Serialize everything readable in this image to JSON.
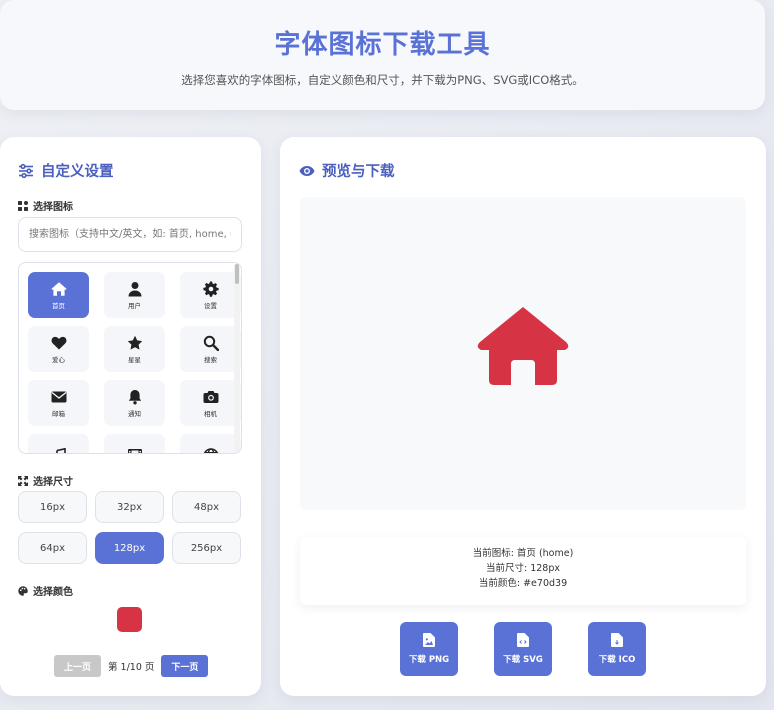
{
  "header": {
    "title": "字体图标下载工具",
    "subtitle": "选择您喜欢的字体图标，自定义颜色和尺寸，并下载为PNG、SVG或ICO格式。"
  },
  "settings": {
    "title": "自定义设置",
    "icon_label": "选择图标",
    "search_placeholder": "搜索图标（支持中文/英文，如: 首页, home, u",
    "icons": [
      {
        "name": "home",
        "label": "首页",
        "active": true
      },
      {
        "name": "user",
        "label": "用户"
      },
      {
        "name": "gear",
        "label": "设置"
      },
      {
        "name": "heart",
        "label": "爱心"
      },
      {
        "name": "star",
        "label": "星星"
      },
      {
        "name": "search",
        "label": "搜索"
      },
      {
        "name": "envelope",
        "label": "邮箱"
      },
      {
        "name": "bell",
        "label": "通知"
      },
      {
        "name": "camera",
        "label": "相机"
      },
      {
        "name": "music",
        "label": ""
      },
      {
        "name": "film",
        "label": ""
      },
      {
        "name": "globe",
        "label": ""
      }
    ],
    "size_label": "选择尺寸",
    "sizes": [
      "16px",
      "32px",
      "48px",
      "64px",
      "128px",
      "256px"
    ],
    "selected_size": "128px",
    "color_label": "选择颜色",
    "swatch_color": "#d63344",
    "pager": {
      "prev": "上一页",
      "status": "第 1/10 页",
      "next": "下一页"
    }
  },
  "preview": {
    "title": "预览与下载",
    "icon_color": "#d63344",
    "current_icon": "当前图标: 首页 (home)",
    "current_size": "当前尺寸: 128px",
    "current_color": "当前颜色: #e70d39",
    "downloads": [
      {
        "label": "下载 PNG",
        "icon": "file-image-icon"
      },
      {
        "label": "下载 SVG",
        "icon": "file-code-icon"
      },
      {
        "label": "下载 ICO",
        "icon": "file-icon"
      }
    ]
  },
  "colors": {
    "accent": "#5a72d6",
    "title": "#4a5fc0"
  }
}
